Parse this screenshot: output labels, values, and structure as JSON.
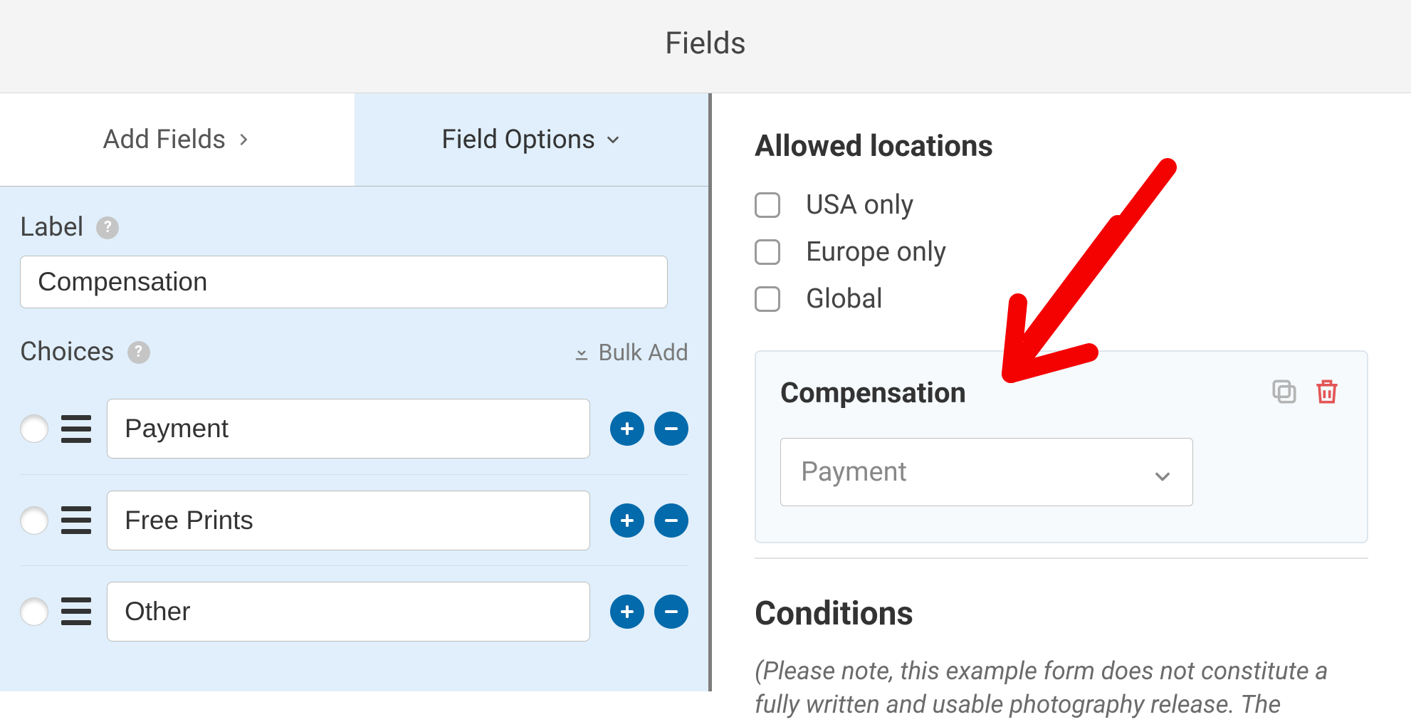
{
  "header": {
    "title": "Fields"
  },
  "tabs": {
    "add_label": "Add Fields",
    "options_label": "Field Options"
  },
  "editor": {
    "label_label": "Label",
    "label_value": "Compensation",
    "choices_label": "Choices",
    "bulk_add_label": "Bulk Add",
    "choices": [
      {
        "value": "Payment"
      },
      {
        "value": "Free Prints"
      },
      {
        "value": "Other"
      }
    ]
  },
  "preview": {
    "allowed_locations_heading": "Allowed locations",
    "location_options": [
      {
        "label": "USA only"
      },
      {
        "label": "Europe only"
      },
      {
        "label": "Global"
      }
    ],
    "field_card": {
      "title": "Compensation",
      "select_value": "Payment"
    },
    "conditions_heading": "Conditions",
    "conditions_note": "(Please note, this example form does not constitute a fully written and usable photography release. The"
  },
  "icons": {
    "help": "?",
    "chevron_right": "chevron-right-icon",
    "chevron_down": "chevron-down-icon",
    "download": "download-icon",
    "plus": "plus-icon",
    "minus": "minus-icon",
    "duplicate": "duplicate-icon",
    "trash": "trash-icon"
  },
  "colors": {
    "accent_blue": "#036aab",
    "panel_blue": "#e0effb",
    "danger": "#e25656",
    "annotation": "#f40101"
  }
}
